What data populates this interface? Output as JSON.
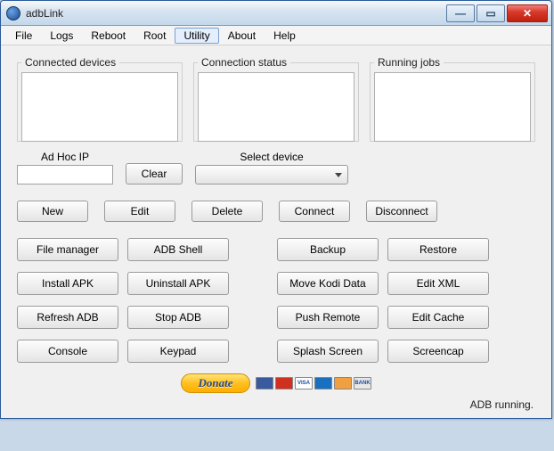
{
  "window": {
    "title": "adbLink"
  },
  "menubar": [
    "File",
    "Logs",
    "Reboot",
    "Root",
    "Utility",
    "About",
    "Help"
  ],
  "menubar_open_index": 4,
  "panels": {
    "devices_legend": "Connected devices",
    "status_legend": "Connection status",
    "jobs_legend": "Running jobs"
  },
  "adhoc": {
    "label": "Ad Hoc IP",
    "value": "",
    "clear_label": "Clear"
  },
  "select": {
    "label": "Select device",
    "value": ""
  },
  "conn_buttons": {
    "new": "New",
    "edit": "Edit",
    "delete": "Delete",
    "connect": "Connect",
    "disconnect": "Disconnect"
  },
  "actions": {
    "file_manager": "File manager",
    "adb_shell": "ADB Shell",
    "backup": "Backup",
    "restore": "Restore",
    "install_apk": "Install APK",
    "uninstall_apk": "Uninstall APK",
    "move_kodi": "Move Kodi Data",
    "edit_xml": "Edit XML",
    "refresh_adb": "Refresh ADB",
    "stop_adb": "Stop ADB",
    "push_remote": "Push Remote",
    "edit_cache": "Edit Cache",
    "console": "Console",
    "keypad": "Keypad",
    "splash": "Splash Screen",
    "screencap": "Screencap"
  },
  "donate": {
    "label": "Donate",
    "cards": [
      "maestro",
      "mastercard",
      "visa",
      "amex",
      "discover",
      "bank"
    ]
  },
  "card_styles": {
    "maestro": "#3a5aa0",
    "mastercard": "#d03020",
    "visa": "#fff",
    "amex": "#1a70c0",
    "discover": "#f0a040",
    "bank": "#e8e8e8"
  },
  "card_text": {
    "maestro": "",
    "mastercard": "",
    "visa": "VISA",
    "amex": "",
    "discover": "",
    "bank": "BANK"
  },
  "status": "ADB running."
}
